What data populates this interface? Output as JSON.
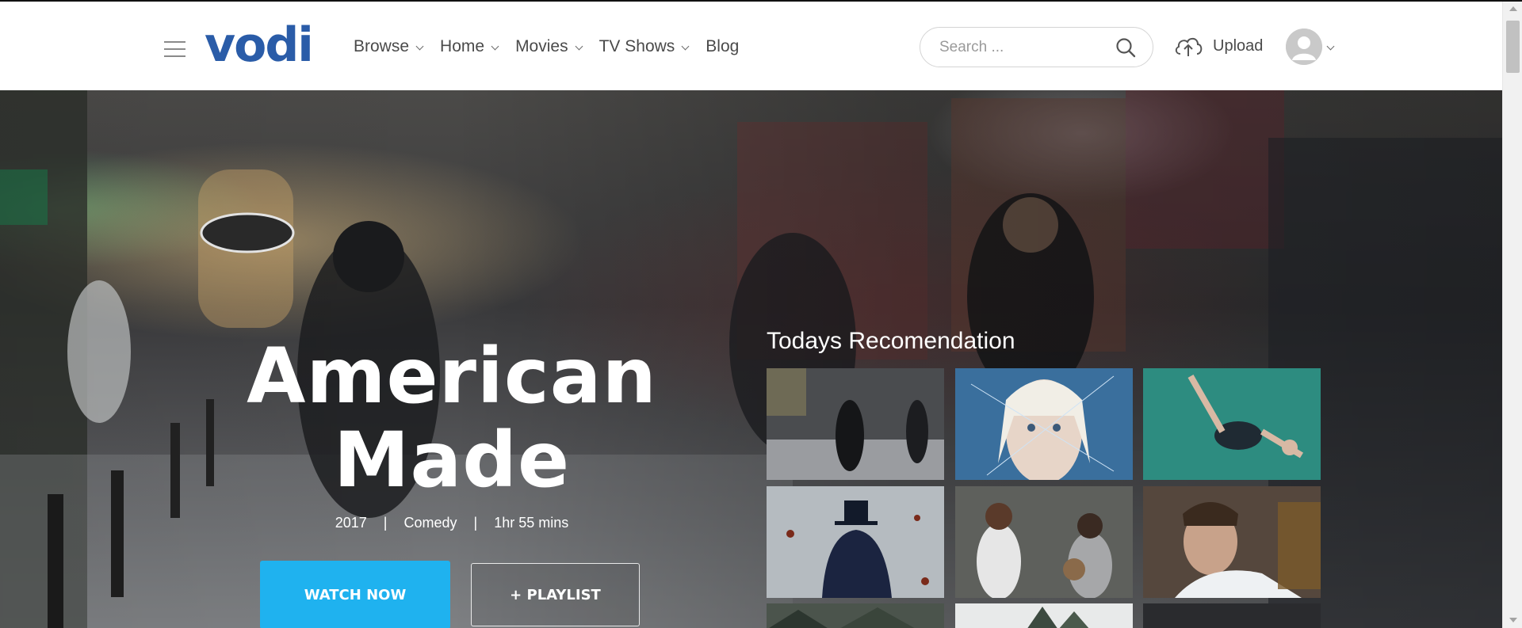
{
  "header": {
    "logo_text": "vodi",
    "nav": [
      {
        "label": "Browse",
        "has_dropdown": true
      },
      {
        "label": "Home",
        "has_dropdown": true
      },
      {
        "label": "Movies",
        "has_dropdown": true
      },
      {
        "label": "TV Shows",
        "has_dropdown": true
      },
      {
        "label": "Blog",
        "has_dropdown": false
      }
    ],
    "search": {
      "placeholder": "Search ..."
    },
    "upload_label": "Upload"
  },
  "hero": {
    "title_line1": "American",
    "title_line2": "Made",
    "meta": {
      "year": "2017",
      "genre": "Comedy",
      "duration": "1hr 55 mins",
      "separator": "|"
    },
    "watch_button": "WATCH NOW",
    "playlist_button": "+ PLAYLIST"
  },
  "recommendation": {
    "title": "Todays Recomendation",
    "thumbnails": [
      {
        "name": "snowy-street-walker",
        "bg": "#4a4c4f"
      },
      {
        "name": "cracked-glass-portrait",
        "bg": "#3d6e9a"
      },
      {
        "name": "underwater-woman",
        "bg": "#2f8a7e"
      },
      {
        "name": "man-in-top-hat",
        "bg": "#b7bcc1"
      },
      {
        "name": "girls-in-room",
        "bg": "#5d5f5c"
      },
      {
        "name": "man-on-sofa",
        "bg": "#5a4b3f"
      },
      {
        "name": "forest-scene",
        "bg": "#47514a"
      },
      {
        "name": "winter-trees",
        "bg": "#e4e6e6"
      },
      {
        "name": "dark-scene",
        "bg": "#2a2b2e"
      }
    ]
  },
  "colors": {
    "brand": "#2a5ca8",
    "accent": "#1fb2ef"
  },
  "icons": [
    "hamburger-icon",
    "search-icon",
    "upload-cloud-icon",
    "user-avatar-icon",
    "chevron-down-icon"
  ]
}
